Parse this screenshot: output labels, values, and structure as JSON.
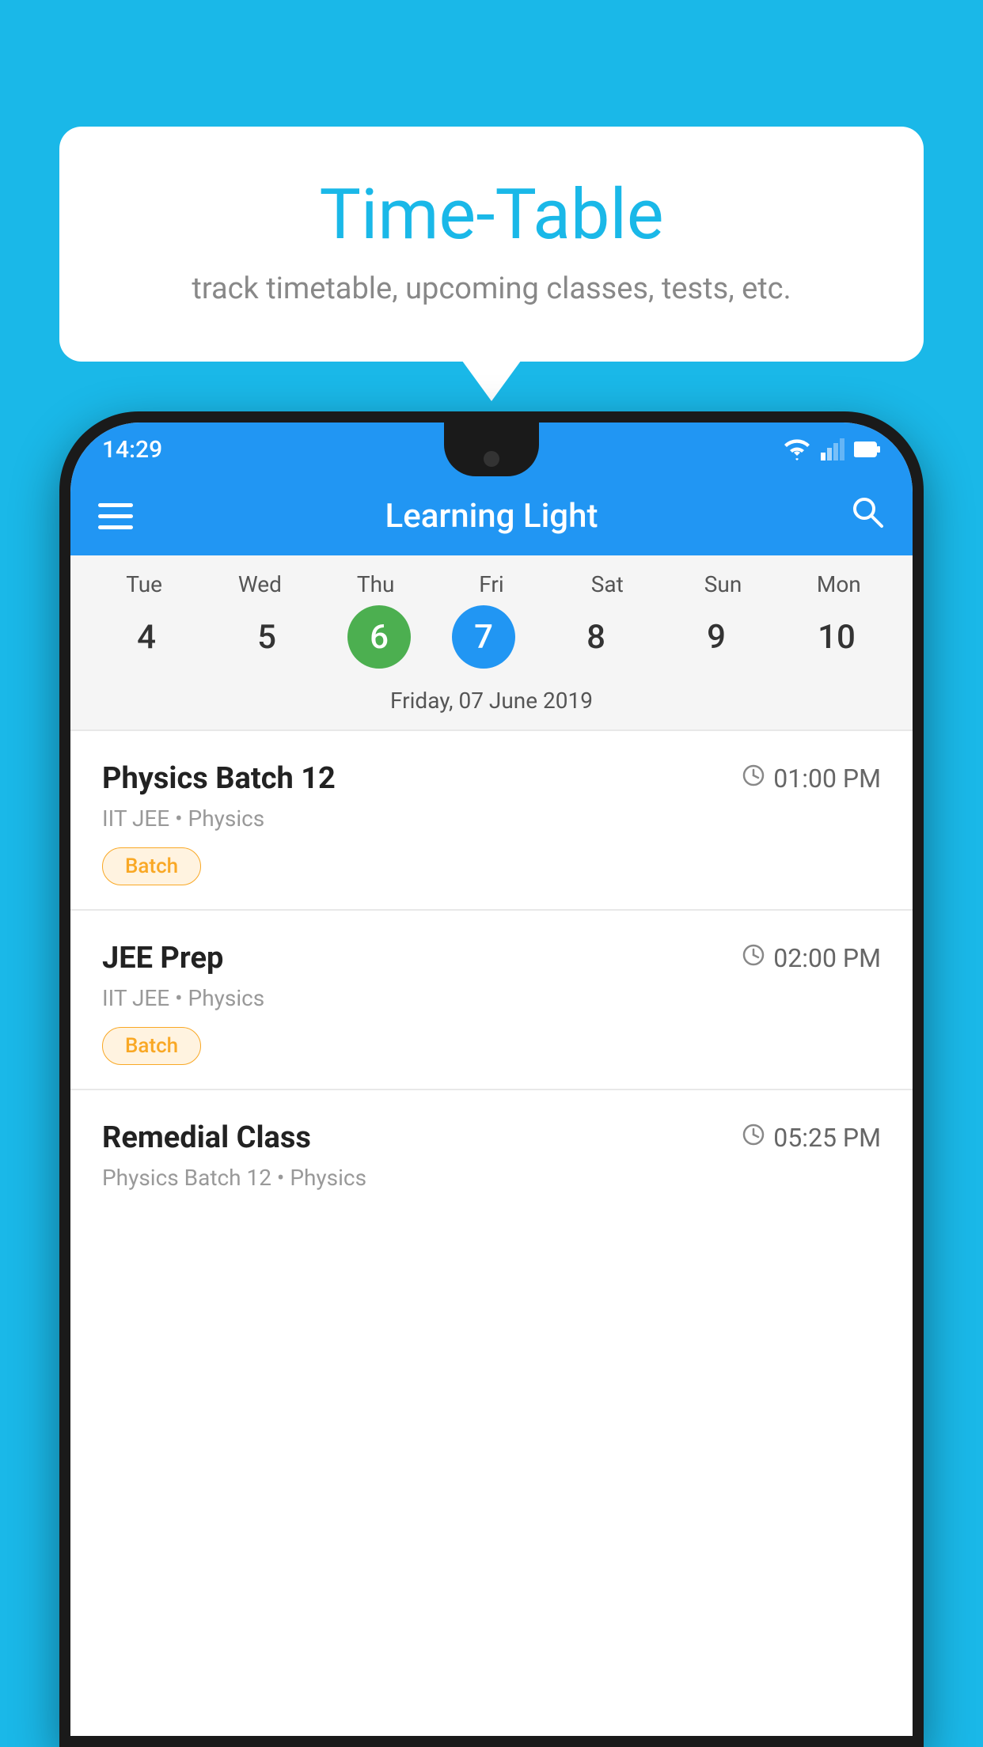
{
  "background_color": "#1ab8e8",
  "tooltip": {
    "title": "Time-Table",
    "subtitle": "track timetable, upcoming classes, tests, etc."
  },
  "phone": {
    "status_bar": {
      "time": "14:29"
    },
    "toolbar": {
      "title": "Learning Light",
      "hamburger_label": "menu",
      "search_label": "search"
    },
    "calendar": {
      "days": [
        {
          "short": "Tue",
          "num": "4"
        },
        {
          "short": "Wed",
          "num": "5"
        },
        {
          "short": "Thu",
          "num": "6",
          "state": "today"
        },
        {
          "short": "Fri",
          "num": "7",
          "state": "selected"
        },
        {
          "short": "Sat",
          "num": "8"
        },
        {
          "short": "Sun",
          "num": "9"
        },
        {
          "short": "Mon",
          "num": "10"
        }
      ],
      "selected_date": "Friday, 07 June 2019"
    },
    "classes": [
      {
        "name": "Physics Batch 12",
        "time": "01:00 PM",
        "subject": "IIT JEE • Physics",
        "tag": "Batch"
      },
      {
        "name": "JEE Prep",
        "time": "02:00 PM",
        "subject": "IIT JEE • Physics",
        "tag": "Batch"
      },
      {
        "name": "Remedial Class",
        "time": "05:25 PM",
        "subject": "Physics Batch 12 • Physics",
        "tag": null
      }
    ]
  }
}
